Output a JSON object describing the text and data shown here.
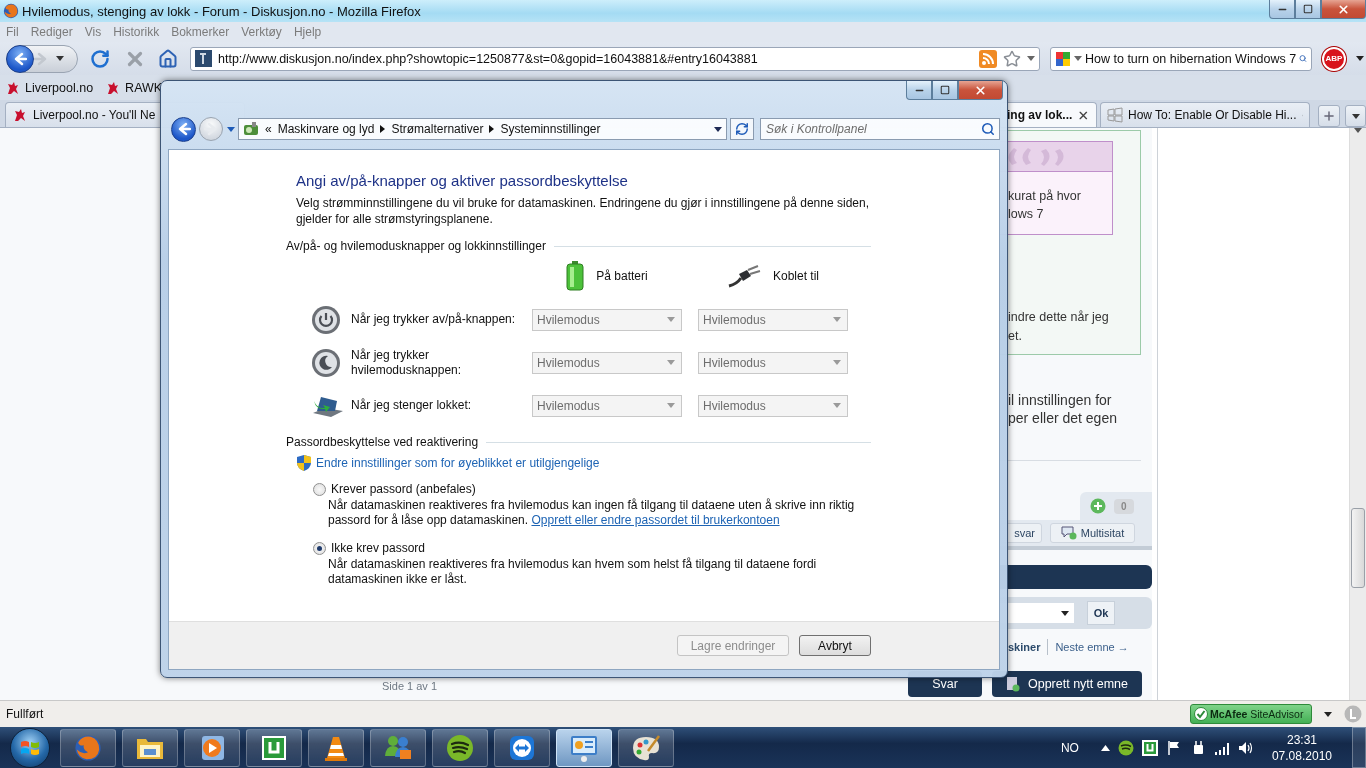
{
  "browser": {
    "title": "Hvilemodus, stenging av lokk - Forum - Diskusjon.no - Mozilla Firefox",
    "menu": [
      "Fil",
      "Rediger",
      "Vis",
      "Historikk",
      "Bokmerker",
      "Verktøy",
      "Hjelp"
    ],
    "address": "http://www.diskusjon.no/index.php?showtopic=1250877&st=0&gopid=16043881&#entry16043881",
    "search": "How to turn on hibernation Windows 7",
    "abp_label": "ABP",
    "bookmarks": [
      "Liverpool.no",
      "RAWK"
    ],
    "tabs": [
      {
        "label": "Liverpool.no - You'll Ne",
        "selected": false,
        "kind": "bird"
      },
      {
        "label": "ing av lok...",
        "selected": true,
        "kind": "none"
      },
      {
        "label": "How To: Enable Or Disable Hi...",
        "selected": false,
        "kind": "windows"
      }
    ],
    "status": "Fullført",
    "siteadvisor": "**McAfee** SiteAdvisor"
  },
  "page": {
    "quote_lines": [
      "kurat på hvor",
      "lows 7"
    ],
    "post_lines": [
      "indre dette når jeg",
      "et."
    ],
    "text_lines": [
      "il innstillingen for",
      "per eller det egen"
    ],
    "vote_count": "0",
    "reply_button": "svar",
    "multiquote_button": "Multisitat",
    "ok_button": "Ok",
    "forum_link": "skiner",
    "next_link": "Neste emne →",
    "page_info": "Side 1 av 1",
    "reply_button_2": "Svar",
    "new_topic_button": "Opprett nytt emne"
  },
  "dialog": {
    "overflow_mark": "«",
    "breadcrumb": [
      "Maskinvare og lyd",
      "Strømalternativer",
      "Systeminnstillinger"
    ],
    "search_placeholder": "Søk i Kontrollpanel",
    "heading": "Angi av/på-knapper og aktiver passordbeskyttelse",
    "intro": "Velg strømminnstillingene du vil bruke for datamaskinen. Endringene du gjør i innstillingene på denne siden, gjelder for alle strømstyringsplanene.",
    "section1": "Av/på- og hvilemodusknapper og lokkinnstillinger",
    "columns": [
      "På batteri",
      "Koblet til"
    ],
    "rows": [
      {
        "kind": "power",
        "label": "Når jeg trykker av/på-knappen:",
        "battery": "Hvilemodus",
        "plugged": "Hvilemodus",
        "disabled": true
      },
      {
        "kind": "sleep",
        "label": "Når jeg trykker hvilemodusknappen:",
        "battery": "Hvilemodus",
        "plugged": "Hvilemodus",
        "disabled": true
      },
      {
        "kind": "lid",
        "label": "Når jeg stenger lokket:",
        "battery": "Hvilemodus",
        "plugged": "Hvilemodus",
        "disabled": true
      }
    ],
    "section2": "Passordbeskyttelse ved reaktivering",
    "shield_link": "Endre innstillinger som for øyeblikket er utilgjengelige",
    "options": [
      {
        "label": "Krever passord (anbefales)",
        "selected": false,
        "description": "Når datamaskinen reaktiveres fra hvilemodus kan ingen få tilgang til dataene uten å skrive inn riktig passord for å låse opp datamaskinen.",
        "link": "Opprett eller endre passordet til brukerkontoen"
      },
      {
        "label": "Ikke krev passord",
        "selected": true,
        "description": "Når datamaskinen reaktiveres fra hvilemodus kan hvem som helst få tilgang til dataene fordi datamaskinen ikke er låst."
      }
    ],
    "buttons": [
      {
        "label": "Lagre endringer",
        "disabled": true
      },
      {
        "label": "Avbryt",
        "disabled": false
      }
    ]
  },
  "taskbar": {
    "apps": [
      {
        "kind": "browser",
        "selected": false
      },
      {
        "kind": "folder",
        "selected": false
      },
      {
        "kind": "media",
        "selected": false
      },
      {
        "kind": "torrent",
        "selected": false
      },
      {
        "kind": "cone",
        "selected": false
      },
      {
        "kind": "people",
        "selected": false
      },
      {
        "kind": "music",
        "selected": false
      },
      {
        "kind": "remote",
        "selected": false
      },
      {
        "kind": "panel",
        "selected": true
      },
      {
        "kind": "paint",
        "selected": false
      }
    ],
    "language": "NO",
    "time": "23:31",
    "date": "07.08.2010"
  }
}
